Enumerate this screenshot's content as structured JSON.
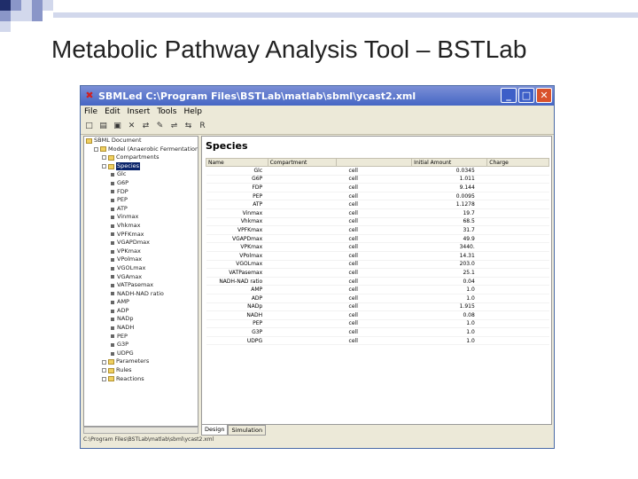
{
  "slide": {
    "title": "Metabolic Pathway Analysis Tool – BSTLab",
    "accent_colors": [
      "#1f2d6a",
      "#8a96c8",
      "#d2d8ec"
    ]
  },
  "window": {
    "title": "SBMLed C:\\Program Files\\BSTLab\\matlab\\sbml\\ycast2.xml",
    "controls": {
      "minimize": "_",
      "maximize": "□",
      "close": "✕"
    }
  },
  "menu": [
    "File",
    "Edit",
    "Insert",
    "Tools",
    "Help"
  ],
  "toolbar": {
    "icons": [
      "new-icon",
      "open-icon",
      "save-icon",
      "delete-icon",
      "add-species-icon",
      "add-reaction-icon",
      "add-rule-icon",
      "validate-icon",
      "zoom-icon"
    ],
    "glyphs": [
      "□",
      "▤",
      "▣",
      "✕",
      "⇄",
      "✎",
      "⇌",
      "⇆",
      "R"
    ]
  },
  "tree": [
    {
      "label": "SBML Document",
      "level": 0,
      "type": "folder"
    },
    {
      "label": "Model (Anaerobic Fermentation)",
      "level": 1,
      "type": "folder"
    },
    {
      "label": "Compartments",
      "level": 2,
      "type": "folder"
    },
    {
      "label": "Species",
      "level": 2,
      "type": "folder",
      "selected": true
    },
    {
      "label": "Glc",
      "level": 3,
      "type": "leaf"
    },
    {
      "label": "G6P",
      "level": 3,
      "type": "leaf"
    },
    {
      "label": "FDP",
      "level": 3,
      "type": "leaf"
    },
    {
      "label": "PEP",
      "level": 3,
      "type": "leaf"
    },
    {
      "label": "ATP",
      "level": 3,
      "type": "leaf"
    },
    {
      "label": "Vinmax",
      "level": 3,
      "type": "leaf"
    },
    {
      "label": "Vhkmax",
      "level": 3,
      "type": "leaf"
    },
    {
      "label": "VPFKmax",
      "level": 3,
      "type": "leaf"
    },
    {
      "label": "VGAPDmax",
      "level": 3,
      "type": "leaf"
    },
    {
      "label": "VPKmax",
      "level": 3,
      "type": "leaf"
    },
    {
      "label": "VPolmax",
      "level": 3,
      "type": "leaf"
    },
    {
      "label": "VGOLmax",
      "level": 3,
      "type": "leaf"
    },
    {
      "label": "VGAmax",
      "level": 3,
      "type": "leaf"
    },
    {
      "label": "VATPasemax",
      "level": 3,
      "type": "leaf"
    },
    {
      "label": "NADH-NAD ratio",
      "level": 3,
      "type": "leaf"
    },
    {
      "label": "AMP",
      "level": 3,
      "type": "leaf"
    },
    {
      "label": "ADP",
      "level": 3,
      "type": "leaf"
    },
    {
      "label": "NADp",
      "level": 3,
      "type": "leaf"
    },
    {
      "label": "NADH",
      "level": 3,
      "type": "leaf"
    },
    {
      "label": "PEP",
      "level": 3,
      "type": "leaf"
    },
    {
      "label": "G3P",
      "level": 3,
      "type": "leaf"
    },
    {
      "label": "UDPG",
      "level": 3,
      "type": "leaf"
    },
    {
      "label": "Parameters",
      "level": 2,
      "type": "folder"
    },
    {
      "label": "Rules",
      "level": 2,
      "type": "folder"
    },
    {
      "label": "Reactions",
      "level": 2,
      "type": "folder"
    }
  ],
  "species_panel": {
    "title": "Species",
    "columns": [
      "Name",
      "Compartment",
      "Initial Amount",
      "Charge"
    ],
    "rows": [
      [
        "Glc",
        "",
        "cell",
        "0.0345",
        ""
      ],
      [
        "G6P",
        "",
        "cell",
        "1.011",
        ""
      ],
      [
        "FDP",
        "",
        "cell",
        "9.144",
        ""
      ],
      [
        "PEP",
        "",
        "cell",
        "0.0095",
        ""
      ],
      [
        "ATP",
        "",
        "cell",
        "1.1278",
        ""
      ],
      [
        "Vinmax",
        "",
        "cell",
        "19.7",
        ""
      ],
      [
        "Vhkmax",
        "",
        "cell",
        "68.5",
        ""
      ],
      [
        "VPFKmax",
        "",
        "cell",
        "31.7",
        ""
      ],
      [
        "VGAPDmax",
        "",
        "cell",
        "49.9",
        ""
      ],
      [
        "VPKmax",
        "",
        "cell",
        "3440.",
        ""
      ],
      [
        "VPolmax",
        "",
        "cell",
        "14.31",
        ""
      ],
      [
        "VGOLmax",
        "",
        "cell",
        "203.0",
        ""
      ],
      [
        "VATPasemax",
        "",
        "cell",
        "25.1",
        ""
      ],
      [
        "NADH-NAD ratio",
        "",
        "cell",
        "0.04",
        ""
      ],
      [
        "AMP",
        "",
        "cell",
        "1.0",
        ""
      ],
      [
        "ADP",
        "",
        "cell",
        "1.0",
        ""
      ],
      [
        "NADp",
        "",
        "cell",
        "1.915",
        ""
      ],
      [
        "NADH",
        "",
        "cell",
        "0.08",
        ""
      ],
      [
        "PEP",
        "",
        "cell",
        "1.0",
        ""
      ],
      [
        "G3P",
        "",
        "cell",
        "1.0",
        ""
      ],
      [
        "UDPG",
        "",
        "cell",
        "1.0",
        ""
      ]
    ]
  },
  "tabs": [
    "Design",
    "Simulation"
  ],
  "status": "C:\\Program Files\\BSTLab\\matlab\\sbml\\ycast2.xml"
}
